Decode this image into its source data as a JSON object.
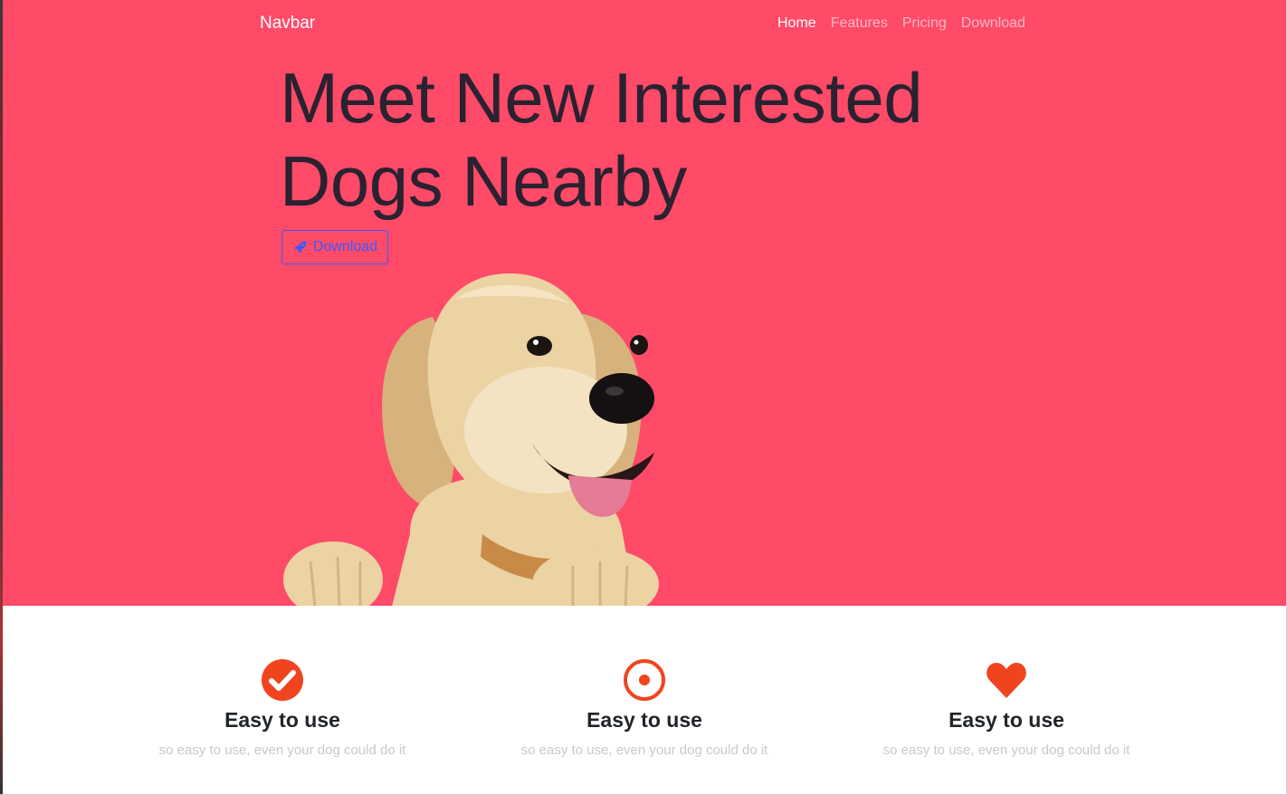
{
  "navbar": {
    "brand": "Navbar",
    "links": [
      {
        "label": "Home",
        "active": true
      },
      {
        "label": "Features",
        "active": false
      },
      {
        "label": "Pricing",
        "active": false
      },
      {
        "label": "Download",
        "active": false
      }
    ]
  },
  "hero": {
    "title": "Meet New Interested Dogs Nearby",
    "download_label": "Download",
    "background_color": "#ff4a68",
    "button_icon": "rocket-icon"
  },
  "features": [
    {
      "icon": "check-circle-icon",
      "title": "Easy to use",
      "text": "so easy to use, even your dog could do it"
    },
    {
      "icon": "bullseye-icon",
      "title": "Easy to use",
      "text": "so easy to use, even your dog could do it"
    },
    {
      "icon": "heart-icon",
      "title": "Easy to use",
      "text": "so easy to use, even your dog could do it"
    }
  ],
  "colors": {
    "accent": "#f0441f",
    "button": "#3b5bff"
  }
}
